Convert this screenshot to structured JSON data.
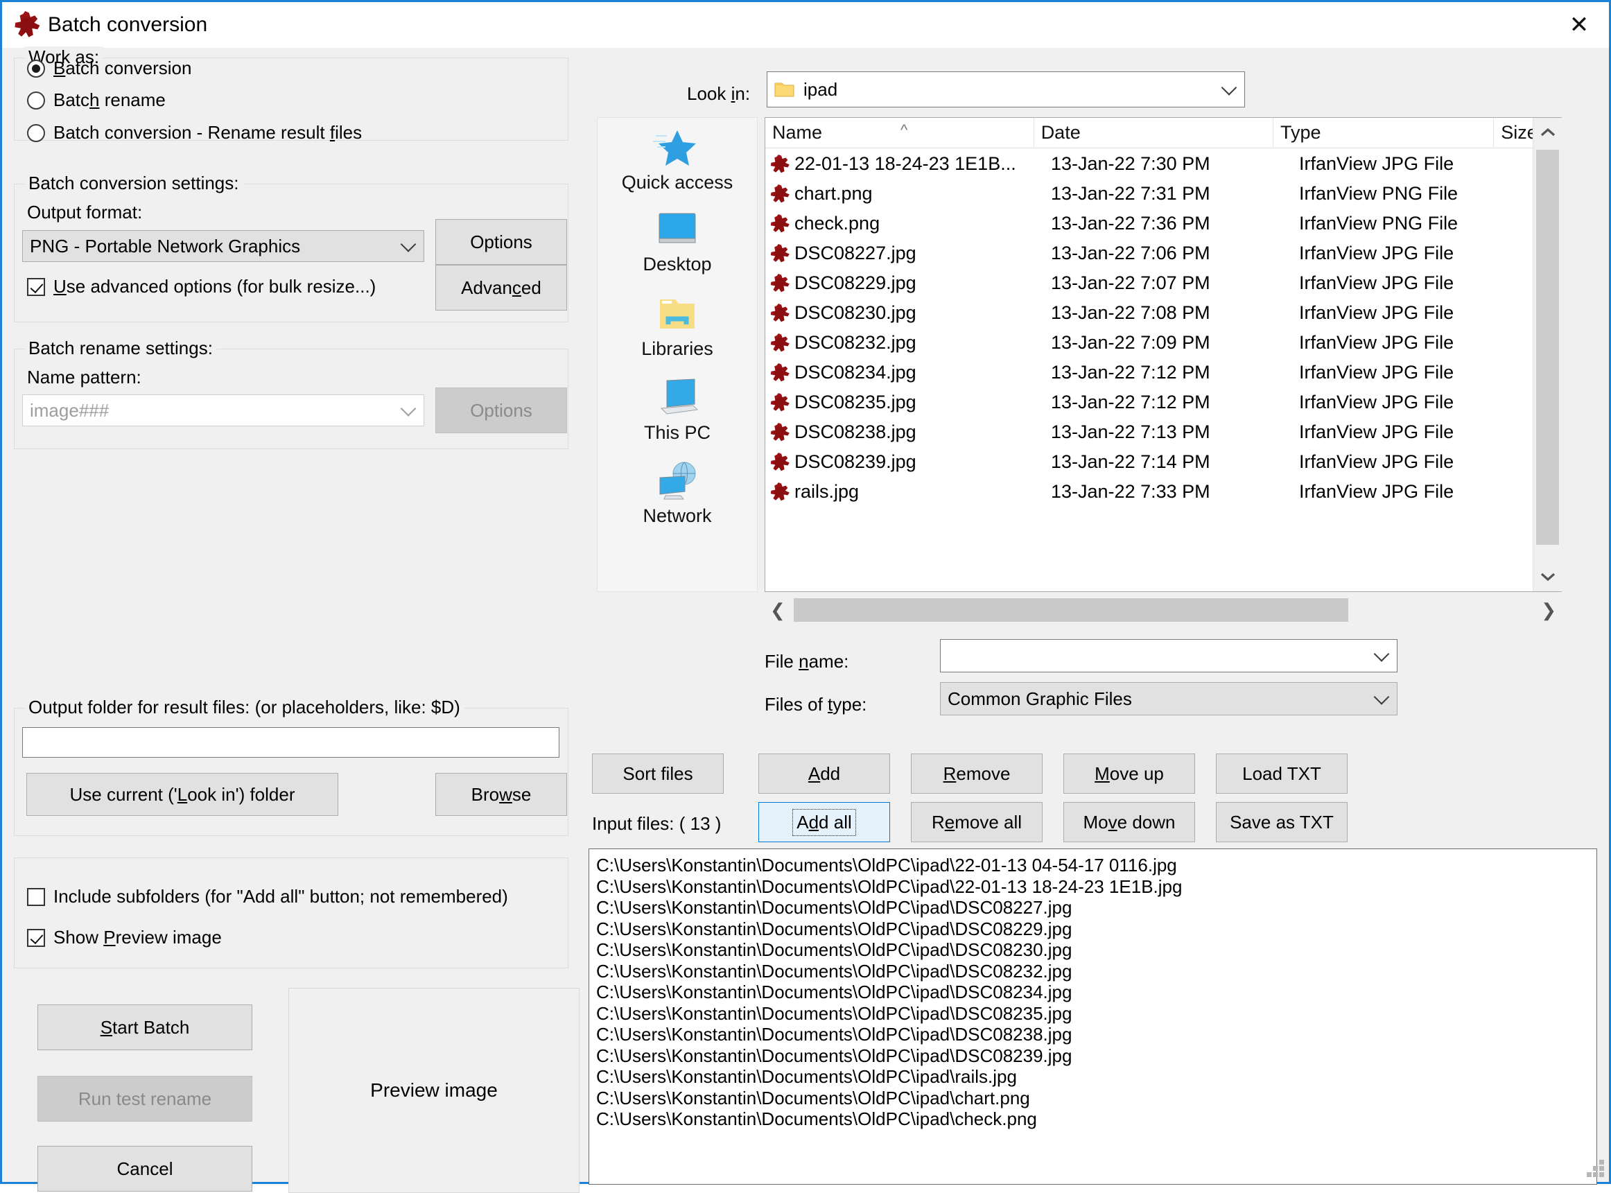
{
  "window": {
    "title": "Batch conversion",
    "title_icon": "irfanview-icon",
    "close_label": "✕"
  },
  "work_as": {
    "legend": "Work as:",
    "options": [
      {
        "label": "Batch conversion",
        "checked": true
      },
      {
        "label": "Batch rename",
        "checked": false
      },
      {
        "label": "Batch conversion - Rename result files",
        "checked": false
      }
    ]
  },
  "conversion_settings": {
    "legend": "Batch conversion settings:",
    "output_format_label": "Output format:",
    "output_format_value": "PNG - Portable Network Graphics",
    "options_button": "Options",
    "advanced_checkbox": "Use advanced options (for bulk resize...)",
    "advanced_checked": true,
    "advanced_button": "Advanced"
  },
  "rename_settings": {
    "legend": "Batch rename settings:",
    "name_pattern_label": "Name pattern:",
    "name_pattern_value": "image###",
    "options_button": "Options"
  },
  "output_folder": {
    "legend": "Output folder for result files: (or placeholders, like: $D)",
    "value": "",
    "use_current_button": "Use current ('Look in') folder",
    "browse_button": "Browse"
  },
  "bottom_checks": {
    "include_subfolders": "Include subfolders (for \"Add all\" button; not remembered)",
    "include_subfolders_checked": false,
    "show_preview": "Show Preview image",
    "show_preview_checked": true
  },
  "action_buttons": {
    "start_batch": "Start Batch",
    "run_test_rename": "Run test rename",
    "run_test_rename_disabled": true,
    "cancel": "Cancel"
  },
  "preview": {
    "placeholder": "Preview image"
  },
  "file_dialog": {
    "look_in_label": "Look in:",
    "look_in_value": "ipad",
    "toolbar_icons": [
      "back-icon",
      "up-folder-icon",
      "new-folder-icon",
      "views-icon",
      "views-dropdown-icon"
    ],
    "places": [
      {
        "label": "Quick access",
        "icon": "quick-access-star-icon"
      },
      {
        "label": "Desktop",
        "icon": "desktop-monitor-icon"
      },
      {
        "label": "Libraries",
        "icon": "libraries-folder-icon"
      },
      {
        "label": "This PC",
        "icon": "this-pc-icon"
      },
      {
        "label": "Network",
        "icon": "network-globe-icon"
      }
    ],
    "columns": [
      "Name",
      "Date",
      "Type",
      "Size"
    ],
    "sort_column": "Name",
    "sort_direction": "ascending",
    "rows": [
      {
        "name": "22-01-13 18-24-23 1E1B...",
        "date": "13-Jan-22 7:30 PM",
        "type": "IrfanView JPG File",
        "size": ""
      },
      {
        "name": "chart.png",
        "date": "13-Jan-22 7:31 PM",
        "type": "IrfanView PNG File",
        "size": ""
      },
      {
        "name": "check.png",
        "date": "13-Jan-22 7:36 PM",
        "type": "IrfanView PNG File",
        "size": ""
      },
      {
        "name": "DSC08227.jpg",
        "date": "13-Jan-22 7:06 PM",
        "type": "IrfanView JPG File",
        "size": ""
      },
      {
        "name": "DSC08229.jpg",
        "date": "13-Jan-22 7:07 PM",
        "type": "IrfanView JPG File",
        "size": ""
      },
      {
        "name": "DSC08230.jpg",
        "date": "13-Jan-22 7:08 PM",
        "type": "IrfanView JPG File",
        "size": ""
      },
      {
        "name": "DSC08232.jpg",
        "date": "13-Jan-22 7:09 PM",
        "type": "IrfanView JPG File",
        "size": ""
      },
      {
        "name": "DSC08234.jpg",
        "date": "13-Jan-22 7:12 PM",
        "type": "IrfanView JPG File",
        "size": ""
      },
      {
        "name": "DSC08235.jpg",
        "date": "13-Jan-22 7:12 PM",
        "type": "IrfanView JPG File",
        "size": ""
      },
      {
        "name": "DSC08238.jpg",
        "date": "13-Jan-22 7:13 PM",
        "type": "IrfanView JPG File",
        "size": ""
      },
      {
        "name": "DSC08239.jpg",
        "date": "13-Jan-22 7:14 PM",
        "type": "IrfanView JPG File",
        "size": ""
      },
      {
        "name": "rails.jpg",
        "date": "13-Jan-22 7:33 PM",
        "type": "IrfanView JPG File",
        "size": ""
      }
    ],
    "file_name_label": "File name:",
    "file_name_value": "",
    "files_of_type_label": "Files of type:",
    "files_of_type_value": "Common Graphic Files"
  },
  "list_buttons": {
    "sort_files": "Sort files",
    "add": "Add",
    "remove": "Remove",
    "move_up": "Move up",
    "load_txt": "Load TXT",
    "add_all": "Add all",
    "remove_all": "Remove all",
    "move_down": "Move down",
    "save_as_txt": "Save as TXT",
    "focused": "add_all"
  },
  "input_files": {
    "label": "Input files: ( 13 )",
    "count": 13,
    "paths": [
      "C:\\Users\\Konstantin\\Documents\\OldPC\\ipad\\22-01-13 04-54-17 0116.jpg",
      "C:\\Users\\Konstantin\\Documents\\OldPC\\ipad\\22-01-13 18-24-23 1E1B.jpg",
      "C:\\Users\\Konstantin\\Documents\\OldPC\\ipad\\DSC08227.jpg",
      "C:\\Users\\Konstantin\\Documents\\OldPC\\ipad\\DSC08229.jpg",
      "C:\\Users\\Konstantin\\Documents\\OldPC\\ipad\\DSC08230.jpg",
      "C:\\Users\\Konstantin\\Documents\\OldPC\\ipad\\DSC08232.jpg",
      "C:\\Users\\Konstantin\\Documents\\OldPC\\ipad\\DSC08234.jpg",
      "C:\\Users\\Konstantin\\Documents\\OldPC\\ipad\\DSC08235.jpg",
      "C:\\Users\\Konstantin\\Documents\\OldPC\\ipad\\DSC08238.jpg",
      "C:\\Users\\Konstantin\\Documents\\OldPC\\ipad\\DSC08239.jpg",
      "C:\\Users\\Konstantin\\Documents\\OldPC\\ipad\\rails.jpg",
      "C:\\Users\\Konstantin\\Documents\\OldPC\\ipad\\chart.png",
      "C:\\Users\\Konstantin\\Documents\\OldPC\\ipad\\check.png"
    ]
  },
  "colors": {
    "window_border": "#1b82d8",
    "dialog_bg": "#f0f0f0",
    "focus_blue": "#0078d7",
    "focus_fill": "#e5f1fb"
  }
}
